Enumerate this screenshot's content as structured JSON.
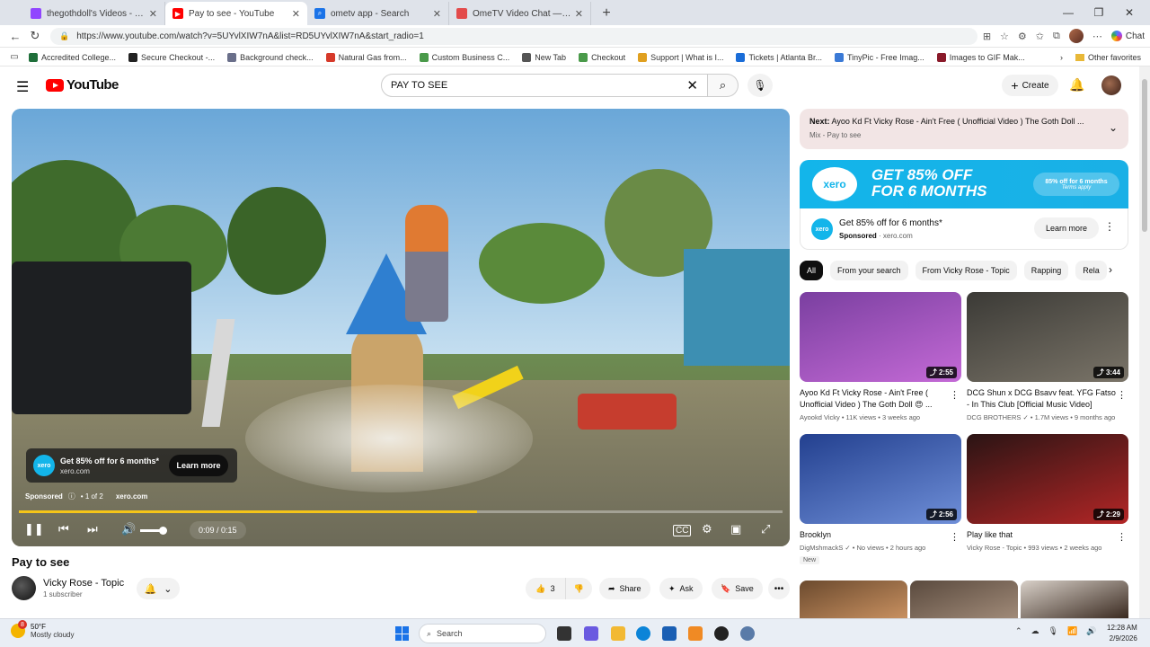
{
  "browser": {
    "tabs": [
      {
        "title": "thegothdoll's Videos - Twitch",
        "active": false
      },
      {
        "title": "Pay to see - YouTube",
        "active": true
      },
      {
        "title": "ometv app - Search",
        "active": false
      },
      {
        "title": "OmeTV Video Chat — Omegle",
        "active": false
      }
    ],
    "url": "https://www.youtube.com/watch?v=5UYvlXIW7nA&list=RD5UYvlXIW7nA&start_radio=1",
    "chat_label": "Chat",
    "bookmarks": [
      "Accredited College...",
      "Secure Checkout -...",
      "Background check...",
      "Natural Gas from...",
      "Custom Business C...",
      "New Tab",
      "Checkout",
      "Support | What is I...",
      "Tickets | Atlanta Br...",
      "TinyPic - Free Imag...",
      "Images to GIF Mak..."
    ],
    "other_favorites": "Other favorites"
  },
  "yt": {
    "logo_text": "YouTube",
    "search_value": "PAY TO SEE",
    "create_label": "Create"
  },
  "player": {
    "ad_title": "Get 85% off for 6 months*",
    "ad_domain": "xero.com",
    "ad_learn": "Learn more",
    "sponsored": "Sponsored",
    "ad_count": "1 of 2",
    "ad_site": "xero.com",
    "time": "0:09 / 0:15",
    "progress": 0.6,
    "logo_short": "xero"
  },
  "video": {
    "title": "Pay to see",
    "channel": "Vicky Rose - Topic",
    "subscribers": "1 subscriber",
    "likes": "3",
    "share": "Share",
    "ask": "Ask",
    "save": "Save"
  },
  "next": {
    "label": "Next:",
    "title": "Ayoo Kd Ft Vicky Rose - Ain't Free ( Unofficial Video ) The Goth Doll ...",
    "mix": "Mix - Pay to see"
  },
  "sidead": {
    "logo": "xero",
    "headline1": "GET 85% OFF",
    "headline2": "FOR 6 MONTHS",
    "chip1": "85% off for 6 months",
    "chip2": "Terms apply",
    "title": "Get 85% off for 6 months*",
    "sponsored": "Sponsored",
    "domain": "xero.com",
    "learn": "Learn more"
  },
  "chips": [
    "All",
    "From your search",
    "From Vicky Rose - Topic",
    "Rapping",
    "Rela"
  ],
  "recs": [
    {
      "title": "Ayoo Kd Ft Vicky Rose - Ain't Free ( Unofficial Video ) The Goth Doll 😍 ...",
      "channel": "Ayookd Vicky",
      "meta": "11K views • 3 weeks ago",
      "duration": "2:55",
      "colors": [
        "#7a3fa0",
        "#c46ad6"
      ]
    },
    {
      "title": "DCG Shun x DCG Bsavv feat. YFG Fatso - In This Club [Official Music Video]",
      "channel": "DCG BROTHERS",
      "meta": "1.7M views • 9 months ago",
      "duration": "3:44",
      "colors": [
        "#3b3a36",
        "#7a7468"
      ]
    },
    {
      "title": "Brooklyn",
      "channel": "DigMshmackS",
      "meta": "No views • 2 hours ago",
      "duration": "2:56",
      "badge": "New",
      "colors": [
        "#23408f",
        "#6f8fd8"
      ]
    },
    {
      "title": "Play like that",
      "channel": "Vicky Rose - Topic",
      "meta": "993 views • 2 weeks ago",
      "duration": "2:29",
      "colors": [
        "#2a1414",
        "#b32626"
      ]
    }
  ],
  "taskbar": {
    "temp": "50°F",
    "weather": "Mostly cloudy",
    "weather_badge": "8",
    "search": "Search",
    "time": "12:28 AM",
    "date": "2/9/2026"
  }
}
